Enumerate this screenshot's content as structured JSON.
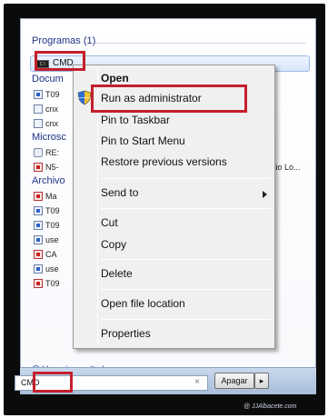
{
  "search_results": {
    "programs": {
      "header": "Programas (1)",
      "items": [
        {
          "label": "CMD",
          "icon": "cmd-icon"
        }
      ]
    },
    "documents": {
      "header": "Docum",
      "items": [
        {
          "label": "T09",
          "icon": "word-doc-icon"
        },
        {
          "label": "cnx",
          "icon": "file-icon"
        },
        {
          "label": "cnx",
          "icon": "file-icon"
        }
      ]
    },
    "microsoft": {
      "header": "Microsc",
      "items": [
        {
          "label": "RE:",
          "icon": "mail-icon"
        },
        {
          "label": "N5-",
          "icon": "pdf-icon"
        }
      ]
    },
    "archive": {
      "header": "Archivo",
      "items": [
        {
          "label": "Ma",
          "icon": "pdf-icon"
        },
        {
          "label": "T09",
          "icon": "word-doc-icon"
        },
        {
          "label": "T09",
          "icon": "word-doc-icon"
        },
        {
          "label": "use",
          "icon": "word-doc-icon"
        },
        {
          "label": "CA",
          "icon": "pdf-icon"
        },
        {
          "label": "use",
          "icon": "word-doc-icon"
        },
        {
          "label": "T09",
          "icon": "pdf-icon"
        }
      ]
    },
    "truncated_right_text": "tio Lo...",
    "see_more": "Ver más resultados"
  },
  "context_menu": {
    "open": "Open",
    "run_as_admin": "Run as administrator",
    "pin_taskbar": "Pin to Taskbar",
    "pin_start": "Pin to Start Menu",
    "restore": "Restore previous versions",
    "send_to": "Send to",
    "cut": "Cut",
    "copy": "Copy",
    "delete": "Delete",
    "open_location": "Open file location",
    "properties": "Properties"
  },
  "search_box": {
    "value": "CMD",
    "clear": "×"
  },
  "buttons": {
    "shutdown": "Apagar",
    "arrow": "▸"
  },
  "watermark": "@ JJAlbacete.com",
  "colors": {
    "highlight_box": "#c41f2c",
    "section_header": "#1e3287"
  }
}
